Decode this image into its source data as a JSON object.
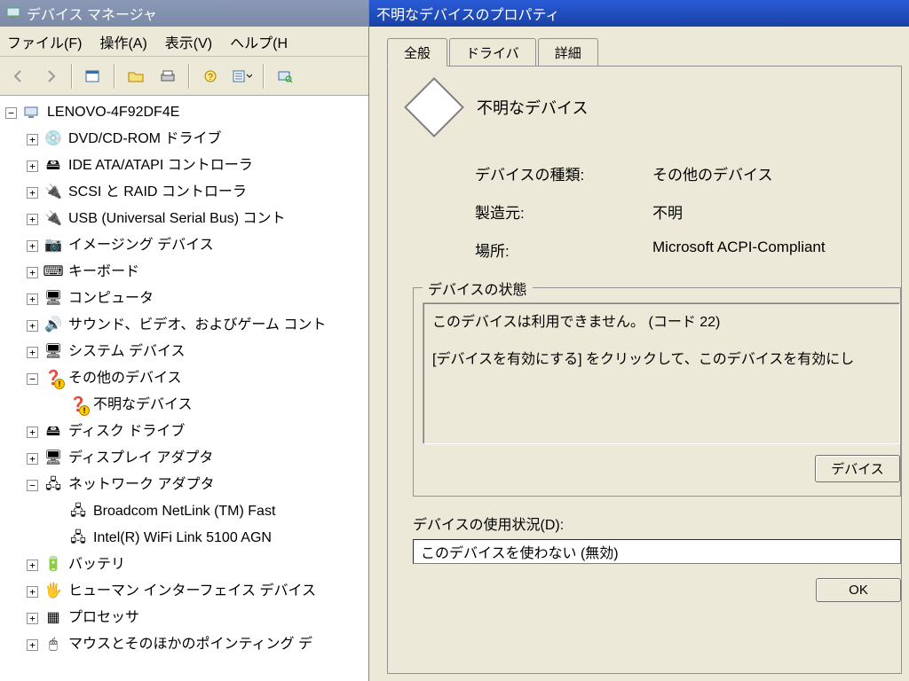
{
  "dm": {
    "title": "デバイス マネージャ",
    "menus": {
      "file": "ファイル(F)",
      "action": "操作(A)",
      "view": "表示(V)",
      "help": "ヘルプ(H"
    },
    "root": "LENOVO-4F92DF4E",
    "nodes": [
      {
        "icon": "💿",
        "label": "DVD/CD-ROM ドライブ",
        "tw": "+"
      },
      {
        "icon": "🖴",
        "label": "IDE ATA/ATAPI コントローラ",
        "tw": "+"
      },
      {
        "icon": "🔌",
        "label": "SCSI と RAID コントローラ",
        "tw": "+"
      },
      {
        "icon": "🔌",
        "label": "USB (Universal Serial Bus) コント",
        "tw": "+"
      },
      {
        "icon": "📷",
        "label": "イメージング デバイス",
        "tw": "+"
      },
      {
        "icon": "⌨",
        "label": "キーボード",
        "tw": "+"
      },
      {
        "icon": "🖥",
        "label": "コンピュータ",
        "tw": "+"
      },
      {
        "icon": "🔊",
        "label": "サウンド、ビデオ、およびゲーム コント",
        "tw": "+"
      },
      {
        "icon": "🖥",
        "label": "システム デバイス",
        "tw": "+"
      },
      {
        "icon": "❓",
        "label": "その他のデバイス",
        "tw": "−",
        "warn": true,
        "children": [
          {
            "icon": "❓",
            "label": "不明なデバイス",
            "warn": true
          }
        ]
      },
      {
        "icon": "🖴",
        "label": "ディスク ドライブ",
        "tw": "+"
      },
      {
        "icon": "🖥",
        "label": "ディスプレイ アダプタ",
        "tw": "+"
      },
      {
        "icon": "🖧",
        "label": "ネットワーク アダプタ",
        "tw": "−",
        "children": [
          {
            "icon": "🖧",
            "label": "Broadcom NetLink (TM) Fast"
          },
          {
            "icon": "🖧",
            "label": "Intel(R) WiFi Link 5100 AGN"
          }
        ]
      },
      {
        "icon": "🔋",
        "label": "バッテリ",
        "tw": "+"
      },
      {
        "icon": "🖐",
        "label": "ヒューマン インターフェイス デバイス",
        "tw": "+"
      },
      {
        "icon": "▦",
        "label": "プロセッサ",
        "tw": "+"
      },
      {
        "icon": "🖱",
        "label": "マウスとそのほかのポインティング デ",
        "tw": "+"
      }
    ]
  },
  "prop": {
    "title": "不明なデバイスのプロパティ",
    "tabs": {
      "general": "全般",
      "driver": "ドライバ",
      "details": "詳細"
    },
    "device_name": "不明なデバイス",
    "labels": {
      "type": "デバイスの種類:",
      "mfr": "製造元:",
      "loc": "場所:"
    },
    "values": {
      "type": "その他のデバイス",
      "mfr": "不明",
      "loc": "Microsoft ACPI-Compliant"
    },
    "status_group_title": "デバイスの状態",
    "status_lines": {
      "l1": "このデバイスは利用できません。 (コード 22)",
      "l2": "[デバイスを有効にする] をクリックして、このデバイスを有効にし"
    },
    "enable_button": "デバイス",
    "usage_label": "デバイスの使用状況(D):",
    "usage_value": "このデバイスを使わない (無効)",
    "ok": "OK"
  }
}
